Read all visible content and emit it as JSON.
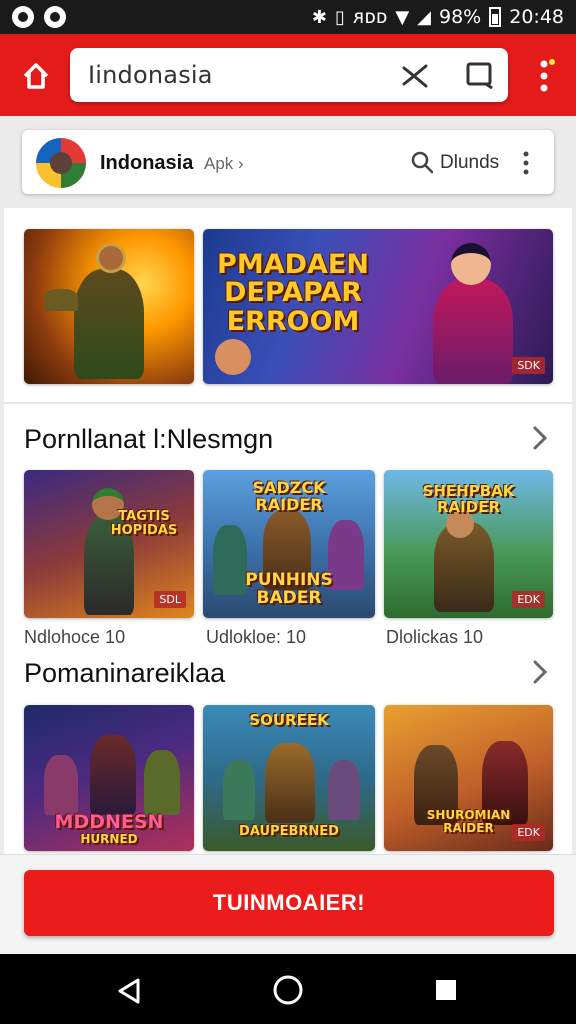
{
  "status_bar": {
    "signal_text": "ᴙᴅᴅ",
    "battery_text": "98%",
    "time": "20:48"
  },
  "header": {
    "search_text": "Iindonasia",
    "icon_names": [
      "home-icon",
      "edit-icon",
      "tab-icon",
      "more-vertical-icon"
    ]
  },
  "app_card": {
    "name": "Indonasia",
    "sub": "Apk ›",
    "search_label": "Dlunds"
  },
  "banners": [
    {
      "title": "",
      "badge": ""
    },
    {
      "title": "PMADAEN\nDEPAPAR\nERROOM",
      "badge": "SDK"
    }
  ],
  "section1": {
    "title": "Pornllanat l:Nlesmgn",
    "items": [
      {
        "title": "TAGTIS\nHOPIDAS",
        "badge": "SDL",
        "caption": "Ndlohoce 10"
      },
      {
        "title": "SADZCK\nRAIDER",
        "subtitle": "PUNHINS\nBADER",
        "badge": "",
        "caption": "Udlokloe: 10"
      },
      {
        "title": "SHEHPBAK\nRAIDER",
        "badge": "EDK",
        "caption": "Dlolickas 10"
      }
    ]
  },
  "section2": {
    "title": "Pomaninareiklaa",
    "items": [
      {
        "title": "MDDNESN",
        "subtitle": "HURNED",
        "badge": ""
      },
      {
        "title": "SOUREEK",
        "subtitle": "DAUPEBRNED",
        "badge": ""
      },
      {
        "title": "SHUROMIAN\nRAIDER",
        "badge": "EDK"
      }
    ]
  },
  "cta": {
    "label": "TUINMOAIER!"
  },
  "nav_icons": [
    "back-icon",
    "home-circle-icon",
    "recent-apps-icon"
  ],
  "colors": {
    "brand_red": "#e41b1b",
    "cta_red": "#ea1c1c"
  }
}
